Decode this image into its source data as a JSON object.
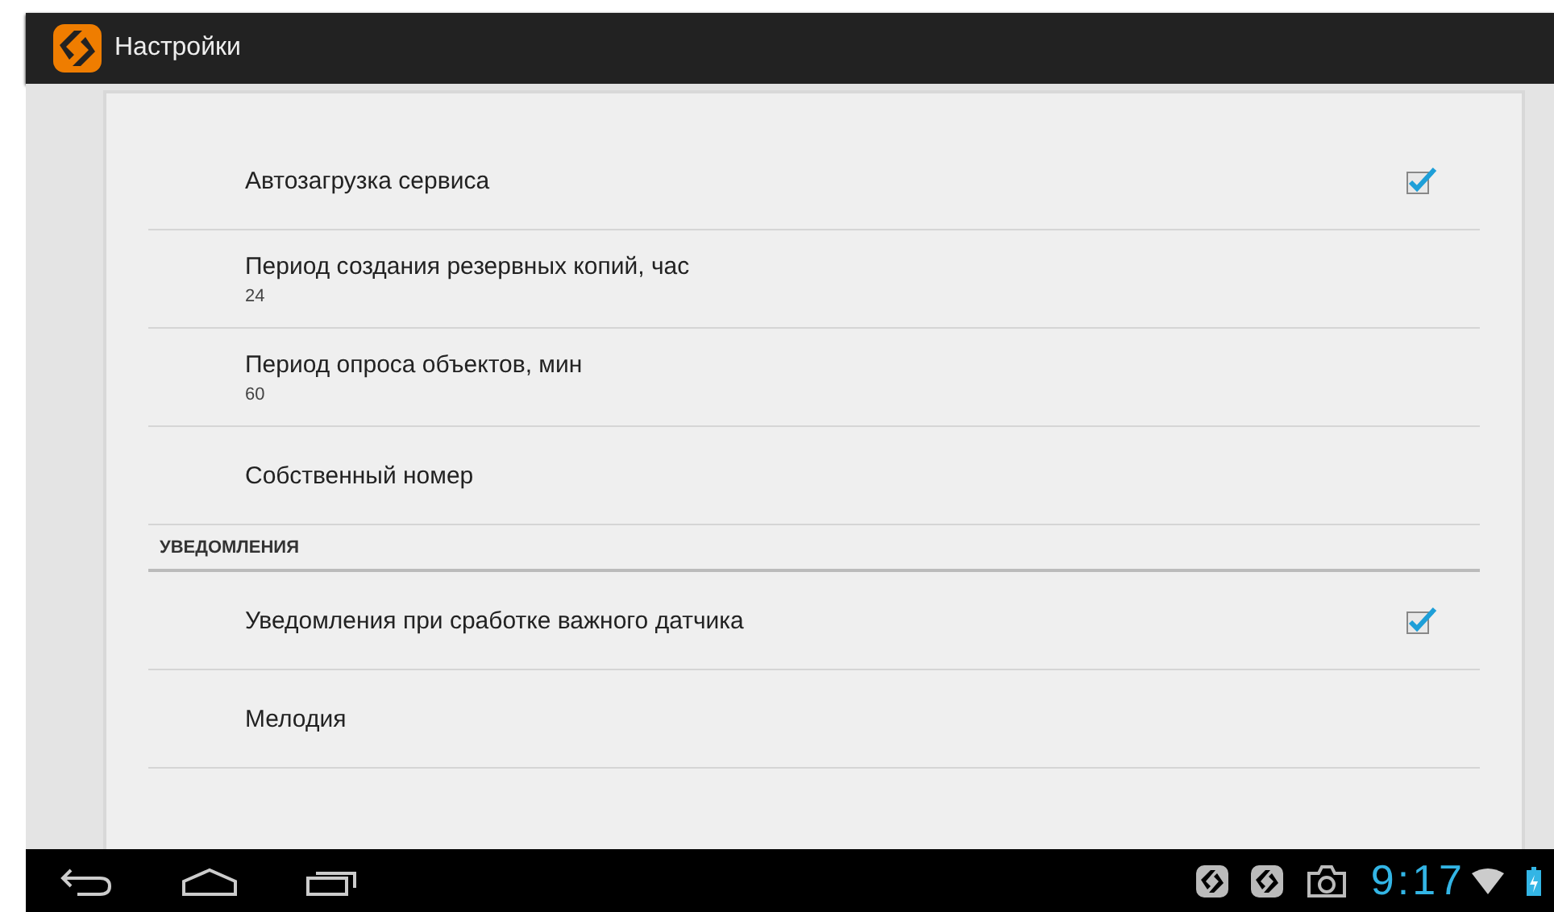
{
  "action_bar": {
    "title": "Настройки"
  },
  "preferences": [
    {
      "kind": "checkbox",
      "title": "Автозагрузка сервиса",
      "checked": true
    },
    {
      "kind": "text",
      "title": "Период создания резервных копий, час",
      "summary": "24"
    },
    {
      "kind": "text",
      "title": "Период опроса объектов, мин",
      "summary": "60"
    },
    {
      "kind": "text",
      "title": "Собственный номер"
    },
    {
      "kind": "category",
      "title": "УВЕДОМЛЕНИЯ"
    },
    {
      "kind": "checkbox",
      "title": "Уведомления при сработке важного датчика",
      "checked": true
    },
    {
      "kind": "text",
      "title": "Мелодия"
    }
  ],
  "status_bar": {
    "time": "9:17"
  }
}
